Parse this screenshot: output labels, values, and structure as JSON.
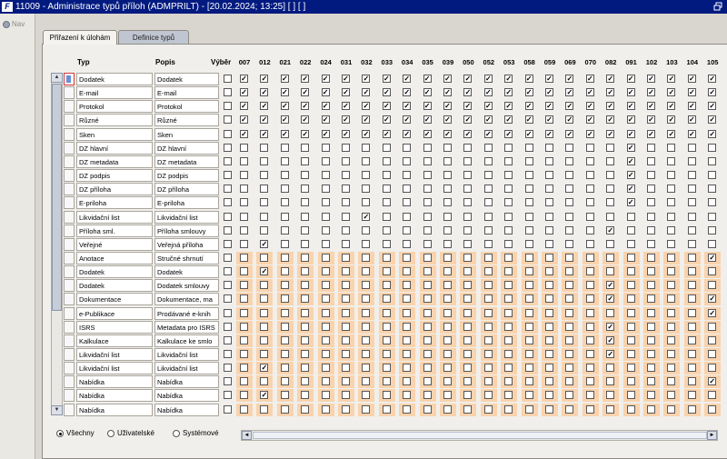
{
  "window": {
    "app_icon": "F",
    "title": "11009 - Administrace typů příloh (ADMPRILT) - [20.02.2024; 13:25]  [ ]  [ ]"
  },
  "nav": {
    "label": "Nav",
    "icon": "nav-icon"
  },
  "tabs": [
    {
      "label": "Přiřazení k úlohám",
      "active": true
    },
    {
      "label": "Definice typů",
      "active": false
    }
  ],
  "grid": {
    "col_typ": "Typ",
    "col_popis": "Popis",
    "col_vyber": "Výběr",
    "codes": [
      "007",
      "012",
      "021",
      "022",
      "024",
      "031",
      "032",
      "033",
      "034",
      "035",
      "039",
      "050",
      "052",
      "053",
      "058",
      "059",
      "069",
      "070",
      "082",
      "091",
      "102",
      "103",
      "104",
      "105"
    ],
    "rows": [
      {
        "typ": "Dodatek",
        "popis": "Dodatek",
        "orange": false,
        "checks": [
          0,
          1,
          2,
          3,
          4,
          5,
          6,
          7,
          8,
          9,
          10,
          11,
          12,
          13,
          14,
          15,
          16,
          17,
          18,
          19,
          20,
          21,
          22,
          23
        ]
      },
      {
        "typ": "E-mail",
        "popis": "E-mail",
        "orange": false,
        "checks": [
          0,
          1,
          2,
          3,
          4,
          5,
          6,
          7,
          8,
          9,
          10,
          11,
          12,
          13,
          14,
          15,
          16,
          17,
          18,
          19,
          20,
          21,
          22,
          23
        ]
      },
      {
        "typ": "Protokol",
        "popis": "Protokol",
        "orange": false,
        "checks": [
          0,
          1,
          2,
          3,
          4,
          5,
          6,
          7,
          8,
          9,
          10,
          11,
          12,
          13,
          14,
          15,
          16,
          17,
          18,
          19,
          20,
          21,
          22,
          23
        ]
      },
      {
        "typ": "Různé",
        "popis": "Různé",
        "orange": false,
        "checks": [
          0,
          1,
          2,
          3,
          4,
          5,
          6,
          7,
          8,
          9,
          10,
          11,
          12,
          13,
          14,
          15,
          16,
          17,
          18,
          19,
          20,
          21,
          22,
          23
        ]
      },
      {
        "typ": "Sken",
        "popis": "Sken",
        "orange": false,
        "checks": [
          0,
          1,
          2,
          3,
          4,
          5,
          6,
          7,
          8,
          9,
          10,
          11,
          12,
          13,
          14,
          15,
          16,
          17,
          18,
          19,
          20,
          21,
          22,
          23
        ]
      },
      {
        "typ": "DZ hlavní",
        "popis": "DZ hlavní",
        "orange": false,
        "checks": [
          19
        ]
      },
      {
        "typ": "DZ metadata",
        "popis": "DZ metadata",
        "orange": false,
        "checks": [
          19
        ]
      },
      {
        "typ": "DZ podpis",
        "popis": "DZ podpis",
        "orange": false,
        "checks": [
          19
        ]
      },
      {
        "typ": "DZ příloha",
        "popis": "DZ příloha",
        "orange": false,
        "checks": [
          19
        ]
      },
      {
        "typ": "E-priloha",
        "popis": "E-priloha",
        "orange": false,
        "checks": [
          19
        ]
      },
      {
        "typ": "Likvidační list",
        "popis": "Likvidační list",
        "orange": false,
        "checks": [
          6
        ]
      },
      {
        "typ": "Příloha sml.",
        "popis": "Příloha smlouvy",
        "orange": false,
        "checks": [
          18
        ]
      },
      {
        "typ": "Veřejné",
        "popis": "Veřejná příloha",
        "orange": false,
        "checks": [
          1
        ]
      },
      {
        "typ": "Anotace",
        "popis": "Stručné shrnutí",
        "orange": true,
        "checks": [
          23
        ]
      },
      {
        "typ": "Dodatek",
        "popis": "Dodatek",
        "orange": true,
        "checks": [
          1
        ]
      },
      {
        "typ": "Dodatek",
        "popis": "Dodatek smlouvy",
        "orange": true,
        "checks": [
          18
        ]
      },
      {
        "typ": "Dokumentace",
        "popis": "Dokumentace, ma",
        "orange": true,
        "checks": [
          18,
          23
        ]
      },
      {
        "typ": "e-Publikace",
        "popis": "Prodávané e-knih",
        "orange": true,
        "checks": [
          23
        ]
      },
      {
        "typ": "ISRS",
        "popis": "Metadata pro ISRS",
        "orange": true,
        "checks": [
          18
        ]
      },
      {
        "typ": "Kalkulace",
        "popis": "Kalkulace ke smlo",
        "orange": true,
        "checks": [
          18
        ]
      },
      {
        "typ": "Likvidační list",
        "popis": "Likvidační list",
        "orange": true,
        "checks": [
          18
        ]
      },
      {
        "typ": "Likvidační list",
        "popis": "Likvidační list",
        "orange": true,
        "checks": [
          1
        ]
      },
      {
        "typ": "Nabídka",
        "popis": "Nabídka",
        "orange": true,
        "checks": [
          23
        ]
      },
      {
        "typ": "Nabídka",
        "popis": "Nabídka",
        "orange": true,
        "checks": [
          1
        ]
      },
      {
        "typ": "Nabídka",
        "popis": "Nabídka",
        "orange": true,
        "checks": []
      }
    ]
  },
  "filter": {
    "options": [
      {
        "label": "Všechny",
        "selected": true
      },
      {
        "label": "Uživatelské",
        "selected": false
      },
      {
        "label": "Systémové",
        "selected": false
      }
    ]
  },
  "scroll": {
    "up": "▲",
    "down": "▼",
    "left": "◄",
    "right": "►"
  },
  "check_glyph": "✓",
  "colors": {
    "title_bar": "#001a80",
    "highlight_cell": "#f9d3ad",
    "tab_inactive": "#bfc6d1"
  }
}
